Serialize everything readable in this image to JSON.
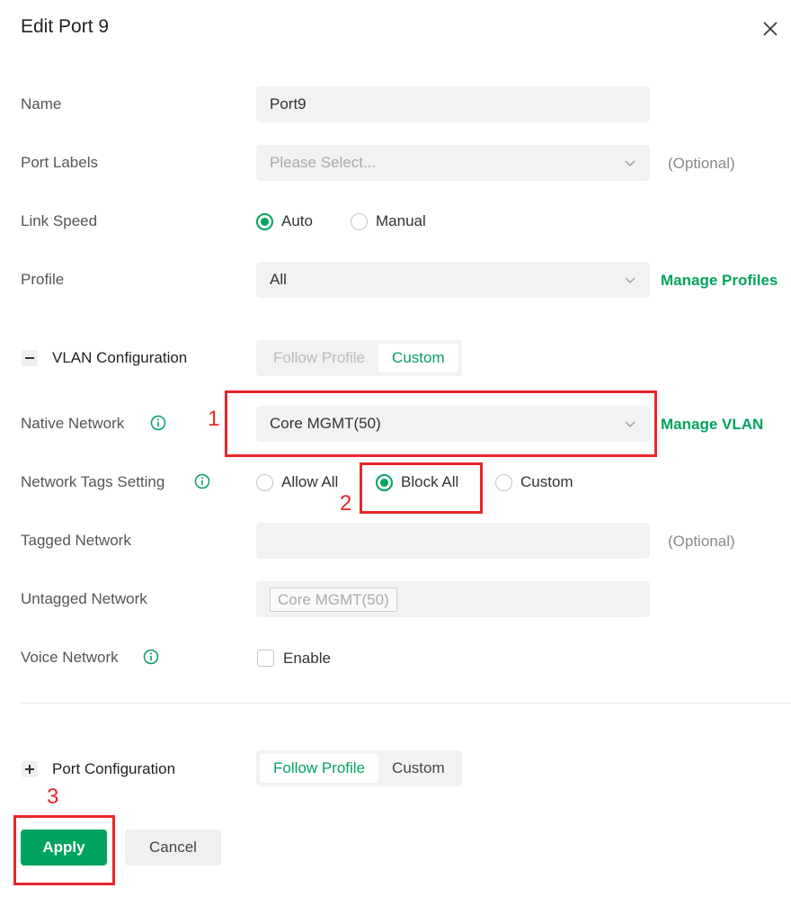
{
  "dialog": {
    "title": "Edit Port 9"
  },
  "name": {
    "label": "Name",
    "value": "Port9"
  },
  "port_labels": {
    "label": "Port Labels",
    "placeholder": "Please Select...",
    "hint": "(Optional)"
  },
  "link_speed": {
    "label": "Link Speed",
    "options": [
      "Auto",
      "Manual"
    ],
    "selected": "Auto"
  },
  "profile": {
    "label": "Profile",
    "value": "All",
    "link": "Manage Profiles"
  },
  "vlan_config": {
    "label": "VLAN Configuration",
    "toggle_symbol": "−",
    "modes": [
      "Follow Profile",
      "Custom"
    ],
    "active_mode": "Custom"
  },
  "native_network": {
    "label": "Native Network",
    "value": "Core MGMT(50)",
    "link": "Manage VLAN"
  },
  "network_tags": {
    "label": "Network Tags Setting",
    "options": [
      "Allow All",
      "Block All",
      "Custom"
    ],
    "selected": "Block All"
  },
  "tagged_network": {
    "label": "Tagged Network",
    "hint": "(Optional)"
  },
  "untagged_network": {
    "label": "Untagged Network",
    "chip": "Core MGMT(50)"
  },
  "voice_network": {
    "label": "Voice Network",
    "checkbox_label": "Enable",
    "checked": false
  },
  "port_config": {
    "label": "Port Configuration",
    "toggle_symbol": "+",
    "modes": [
      "Follow Profile",
      "Custom"
    ],
    "active_mode": "Follow Profile"
  },
  "actions": {
    "apply": "Apply",
    "cancel": "Cancel"
  },
  "annotations": [
    "1",
    "2",
    "3"
  ],
  "colors": {
    "accent": "#00a35e",
    "annotation": "#e8262b",
    "field_bg": "#f2f2f2"
  },
  "icons": [
    "close-icon",
    "chevron-down-icon",
    "info-icon",
    "minus-icon",
    "plus-icon"
  ]
}
